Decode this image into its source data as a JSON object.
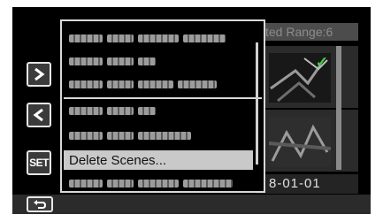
{
  "background": {
    "header_text": "ted Range:6",
    "date_text": "8-01-01",
    "check_glyph": "✓"
  },
  "side_buttons": {
    "next_icon": "chevron-right-icon",
    "prev_icon": "chevron-left-icon",
    "set_label": "SET",
    "return_icon": "return-arrow-icon"
  },
  "menu": {
    "selected_label": "Delete Scenes...",
    "item_count": 8,
    "selected_index": 6,
    "colors": {
      "selected_bg": "#c9c9c9",
      "border": "#d8d8d8"
    }
  }
}
